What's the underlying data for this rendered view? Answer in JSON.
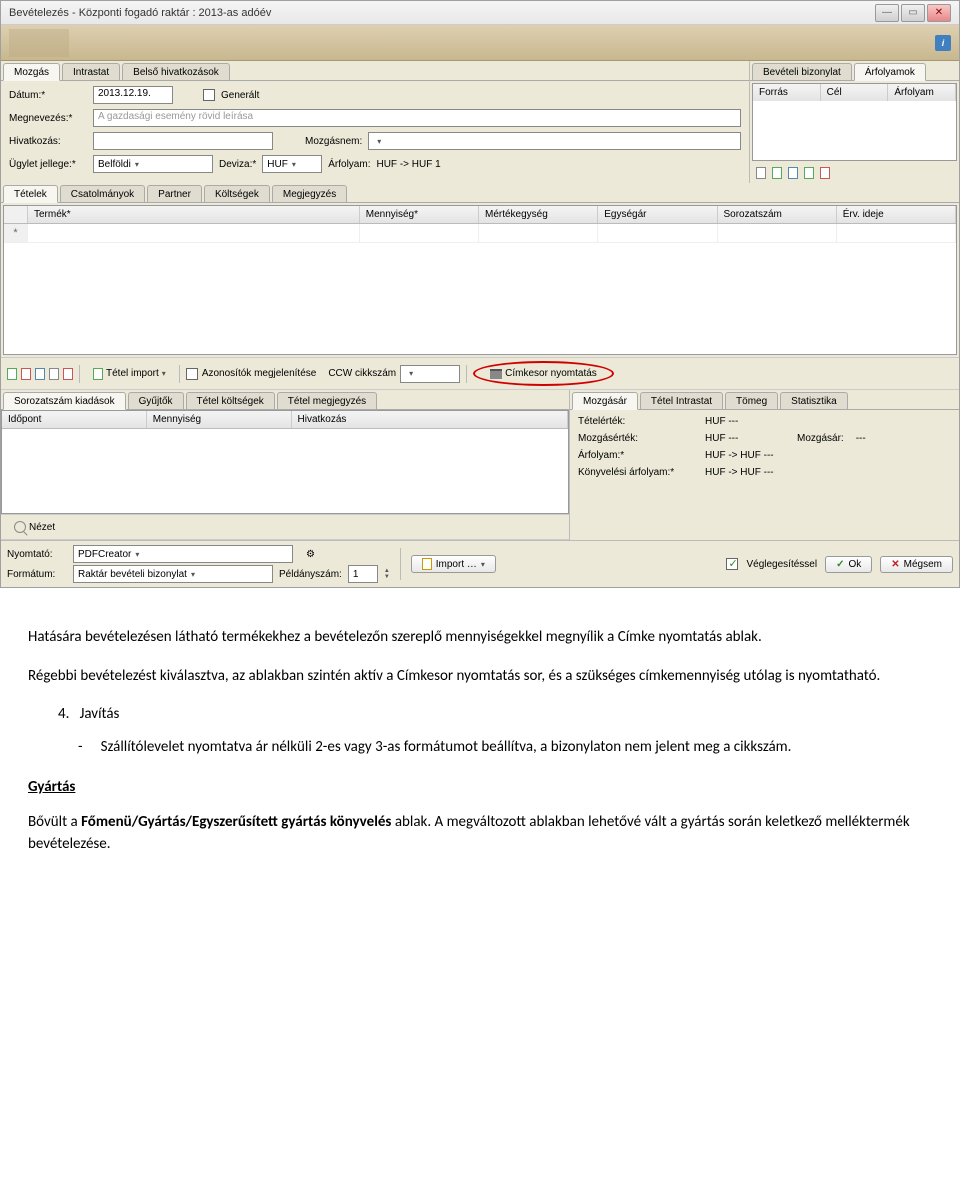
{
  "window": {
    "title": "Bevételezés - Központi fogadó raktár : 2013-as adóév"
  },
  "topTabs": {
    "left": [
      "Mozgás",
      "Intrastat",
      "Belső hivatkozások"
    ],
    "right": [
      "Bevételi bizonylat",
      "Árfolyamok"
    ]
  },
  "form": {
    "datumLabel": "Dátum:*",
    "datumValue": "2013.12.19.",
    "generalt": "Generált",
    "megnevezesLabel": "Megnevezés:*",
    "megnevezesPlaceholder": "A gazdasági esemény rövid leírása",
    "hivatkozasLabel": "Hivatkozás:",
    "mozgasnemLabel": "Mozgásnem:",
    "ugyletLabel": "Ügylet jellege:*",
    "ugyletValue": "Belföldi",
    "devizaLabel": "Deviza:*",
    "devizaValue": "HUF",
    "arfolyamLabel": "Árfolyam:",
    "arfolyamText": "HUF  ->  HUF   1"
  },
  "exrate": {
    "cols": [
      "Forrás",
      "Cél",
      "Árfolyam"
    ]
  },
  "detailTabs": [
    "Tételek",
    "Csatolmányok",
    "Partner",
    "Költségek",
    "Megjegyzés"
  ],
  "gridCols": [
    "Termék*",
    "Mennyiség*",
    "Mértékegység",
    "Egységár",
    "Sorozatszám",
    "Érv. ideje"
  ],
  "toolbar": {
    "tetelImport": "Tétel import",
    "azonositok": "Azonosítók megjelenítése",
    "ccwCikkszam": "CCW cikkszám",
    "cimkesor": "Címkesor nyomtatás"
  },
  "botTabsLeft": [
    "Sorozatszám kiadások",
    "Gyűjtők",
    "Tétel költségek",
    "Tétel megjegyzés"
  ],
  "botGridCols": [
    "Időpont",
    "Mennyiség",
    "Hivatkozás"
  ],
  "nezet": "Nézet",
  "botTabsRight": [
    "Mozgásár",
    "Tétel Intrastat",
    "Tömeg",
    "Statisztika"
  ],
  "mozgasar": {
    "tetelertekLabel": "Tételérték:",
    "tetelertekVal": "HUF   ---",
    "mozgasertekLabel": "Mozgásérték:",
    "mozgasertekVal": "HUF   ---",
    "mozgasarLabel": "Mozgásár:",
    "mozgasarVal": "---",
    "arfolyamLabel": "Árfolyam:*",
    "arfolyamVal": "HUF  ->  HUF   ---",
    "konyvelesiLabel": "Könyvelési árfolyam:*",
    "konyvelesiVal": "HUF  ->  HUF   ---"
  },
  "footer": {
    "nyomtatoLabel": "Nyomtató:",
    "nyomtatoVal": "PDFCreator",
    "formatumLabel": "Formátum:",
    "formatumVal": "Raktár bevételi bizonylat",
    "peldanyszamLabel": "Példányszám:",
    "peldanyszamVal": "1",
    "import": "Import …",
    "veglegesites": "Véglegesítéssel",
    "ok": "Ok",
    "megsem": "Mégsem"
  },
  "doc": {
    "p1": "Hatására bevételezésen látható termékekhez a bevételezőn szereplő mennyiségekkel megnyílik a Címke nyomtatás ablak.",
    "p2": "Régebbi bevételezést kiválasztva, az ablakban szintén aktív a Címkesor nyomtatás sor, és a szükséges címkemennyiség utólag is nyomtatható.",
    "num": "4.",
    "numText": "Javítás",
    "bulletDash": "-",
    "bullet": "Szállítólevelet nyomtatva ár nélküli 2-es vagy 3-as formátumot beállítva, a bizonylaton nem jelent meg a cikkszám.",
    "h2": "Gyártás",
    "p3a": "Bővült a ",
    "p3b": "Főmenü/Gyártás/Egyszerűsített gyártás könyvelés",
    "p3c": " ablak. A megváltozott ablakban lehetővé vált a gyártás során keletkező melléktermék bevételezése."
  }
}
